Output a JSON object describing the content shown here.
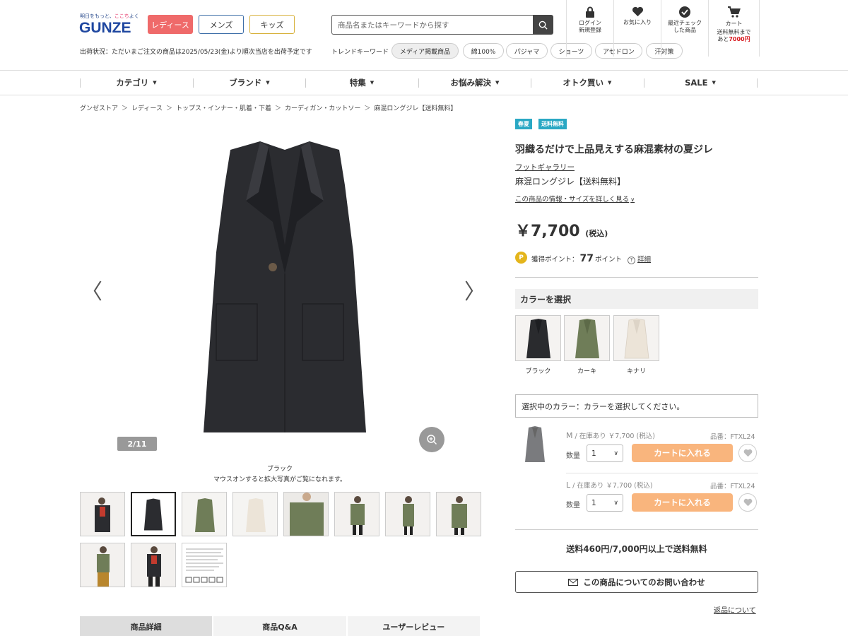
{
  "header": {
    "tagline_a": "明日をもっと、",
    "tagline_b": "ここち",
    "tagline_c": "よく",
    "logo": "GUNZE",
    "categories": [
      "レディース",
      "メンズ",
      "キッズ"
    ],
    "shipping_status": "出荷状況：ただいまご注文の商品は2025/05/23(金)より順次当店を出荷予定です",
    "search_placeholder": "商品名またはキーワードから探す",
    "trend_label": "トレンドキーワード",
    "trend_chips": [
      "メディア掲載商品",
      "綿100%",
      "パジャマ",
      "ショーツ",
      "アセドロン",
      "汗対策"
    ],
    "icons": {
      "login": "ログイン\n新規登録",
      "favorite": "お気に入り",
      "recent": "最近チェック\nした商品",
      "cart": "カート",
      "cart_note_a": "送料無料まで",
      "cart_note_b": "あと",
      "cart_note_amount": "7000円"
    }
  },
  "nav": [
    "カテゴリ",
    "ブランド",
    "特集",
    "お悩み解決",
    "オトク買い",
    "SALE"
  ],
  "breadcrumb": [
    "グンゼストア",
    "レディース",
    "トップス・インナー・肌着・下着",
    "カーディガン・カットソー",
    "麻混ロングジレ【送料無料】"
  ],
  "gallery": {
    "counter": "2/11",
    "color_caption": "ブラック",
    "zoom_hint": "マウスオンすると拡大写真がご覧になれます。",
    "tabs": [
      "商品詳細",
      "商品Q&A",
      "ユーザーレビュー"
    ]
  },
  "product": {
    "badges": [
      "春夏",
      "送料無料"
    ],
    "title": "羽織るだけで上品見えする麻混素材の夏ジレ",
    "brand": "フットギャラリー",
    "name": "麻混ロングジレ【送料無料】",
    "detail_link": "この商品の情報・サイズを詳しく見る",
    "price": "￥7,700",
    "tax": "(税込)",
    "points_icon": "P",
    "points_label": "獲得ポイント：",
    "points_value": "77",
    "points_unit": "ポイント",
    "points_help": "詳細",
    "color_heading": "カラーを選択",
    "colors": [
      {
        "label": "ブラック",
        "hex": "#2a2b2e"
      },
      {
        "label": "カーキ",
        "hex": "#6f7d58"
      },
      {
        "label": "キナリ",
        "hex": "#ece4d8"
      }
    ],
    "selected_color_text": "選択中のカラー：カラーを選択してください。",
    "variants": [
      {
        "size": "M",
        "stock": "/ 在庫あり ￥7,700 (税込)",
        "code": "品番：FTXL24",
        "qty_label": "数量",
        "qty": "1",
        "cart": "カートに入れる"
      },
      {
        "size": "L",
        "stock": "/ 在庫あり ￥7,700 (税込)",
        "code": "品番：FTXL24",
        "qty_label": "数量",
        "qty": "1",
        "cart": "カートに入れる"
      }
    ],
    "shipping_fee": "送料460円/7,000円以上で送料無料",
    "inquiry": "この商品についてのお問い合わせ",
    "returns": "返品について"
  },
  "colors": {
    "accent_red": "#ef6a6a",
    "cart_orange": "#f9b57d",
    "badge_blue": "#2aa8c4",
    "logo_blue": "#1f47a0"
  }
}
